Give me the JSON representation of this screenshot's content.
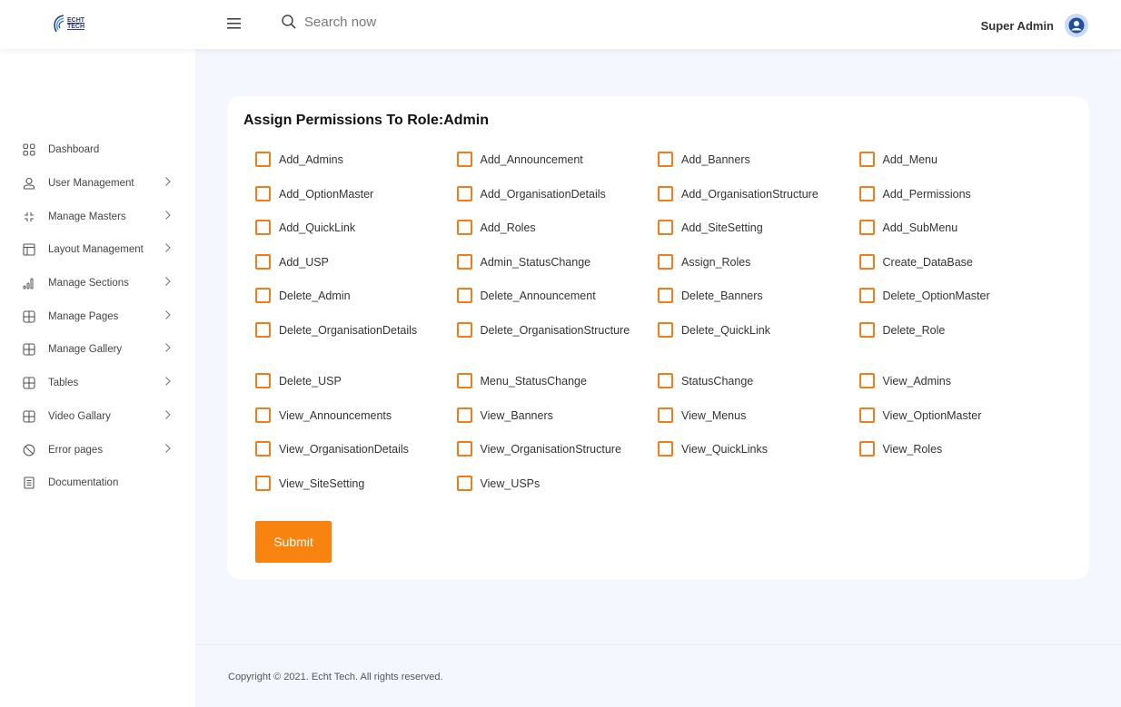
{
  "header": {
    "logo_text": "ECHT TECH",
    "search_placeholder": "Search now",
    "user_name": "Super Admin"
  },
  "sidebar": {
    "items": [
      {
        "label": "Dashboard",
        "icon": "grid-icon",
        "has_chevron": false
      },
      {
        "label": "User Management",
        "icon": "user-icon",
        "has_chevron": true
      },
      {
        "label": "Manage Masters",
        "icon": "collapse-icon",
        "has_chevron": true
      },
      {
        "label": "Layout Management",
        "icon": "layout-icon",
        "has_chevron": true
      },
      {
        "label": "Manage Sections",
        "icon": "bar-chart-icon",
        "has_chevron": true
      },
      {
        "label": "Manage Pages",
        "icon": "table-icon",
        "has_chevron": true
      },
      {
        "label": "Manage Gallery",
        "icon": "table-icon",
        "has_chevron": true
      },
      {
        "label": "Tables",
        "icon": "table-icon",
        "has_chevron": true
      },
      {
        "label": "Video Gallary",
        "icon": "table-icon",
        "has_chevron": true
      },
      {
        "label": "Error pages",
        "icon": "ban-icon",
        "has_chevron": true
      },
      {
        "label": "Documentation",
        "icon": "document-icon",
        "has_chevron": false
      }
    ]
  },
  "main": {
    "title": "Assign Permissions To Role:Admin",
    "permissions": [
      "Add_Admins",
      "Add_Announcement",
      "Add_Banners",
      "Add_Menu",
      "Add_OptionMaster",
      "Add_OrganisationDetails",
      "Add_OrganisationStructure",
      "Add_Permissions",
      "Add_QuickLink",
      "Add_Roles",
      "Add_SiteSetting",
      "Add_SubMenu",
      "Add_USP",
      "Admin_StatusChange",
      "Assign_Roles",
      "Create_DataBase",
      "Delete_Admin",
      "Delete_Announcement",
      "Delete_Banners",
      "Delete_OptionMaster",
      "Delete_OrganisationDetails",
      "Delete_OrganisationStructure",
      "Delete_QuickLink",
      "Delete_Role",
      "Delete_USP",
      "Menu_StatusChange",
      "StatusChange",
      "View_Admins",
      "View_Announcements",
      "View_Banners",
      "View_Menus",
      "View_OptionMaster",
      "View_OrganisationDetails",
      "View_OrganisationStructure",
      "View_QuickLinks",
      "View_Roles",
      "View_SiteSetting",
      "View_USPs"
    ],
    "submit_label": "Submit"
  },
  "footer": {
    "text": "Copyright © 2021. Echt Tech. All rights reserved."
  },
  "colors": {
    "accent": "#f8830e",
    "checkbox_border": "#f07d1a",
    "page_bg": "#f4f7fd"
  }
}
